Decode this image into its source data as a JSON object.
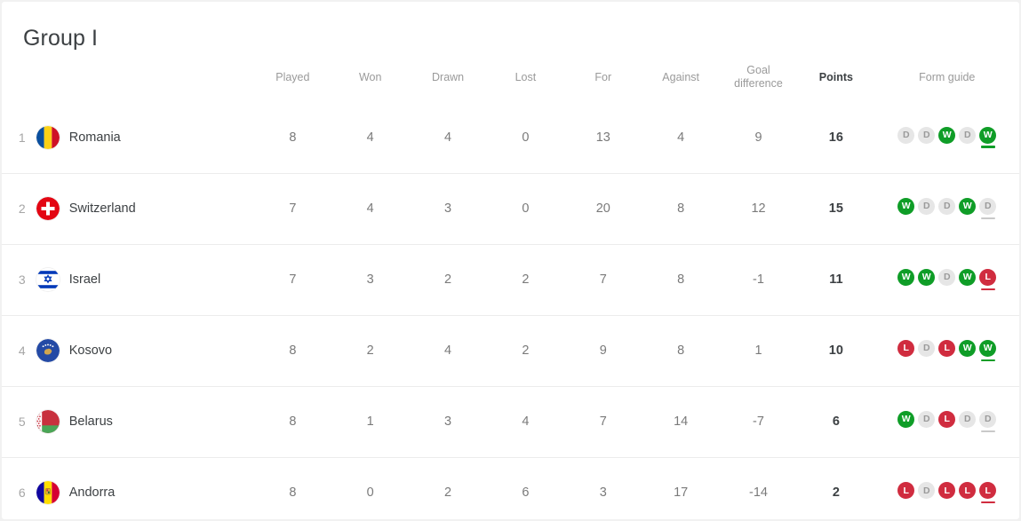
{
  "page_title": "Group I",
  "columns": {
    "rank": "",
    "team": "",
    "played": "Played",
    "won": "Won",
    "drawn": "Drawn",
    "lost": "Lost",
    "for": "For",
    "against": "Against",
    "goal_difference_line1": "Goal",
    "goal_difference_line2": "difference",
    "points": "Points",
    "form_guide": "Form guide"
  },
  "colors": {
    "win": "#0f9d27",
    "loss": "#d02c3f",
    "draw": "#e6e6e6",
    "text_primary": "#3c4043",
    "text_secondary": "#7a7a7a",
    "card_background": "#ffffff",
    "row_divider": "#ececec"
  },
  "rows": [
    {
      "rank": "1",
      "team": "Romania",
      "flag": "flag-romania",
      "played": "8",
      "won": "4",
      "drawn": "4",
      "lost": "0",
      "for": "13",
      "against": "4",
      "goal_difference": "9",
      "points": "16",
      "form": [
        "D",
        "D",
        "W",
        "D",
        "W"
      ],
      "form_latest_index": 4
    },
    {
      "rank": "2",
      "team": "Switzerland",
      "flag": "flag-switzerland",
      "played": "7",
      "won": "4",
      "drawn": "3",
      "lost": "0",
      "for": "20",
      "against": "8",
      "goal_difference": "12",
      "points": "15",
      "form": [
        "W",
        "D",
        "D",
        "W",
        "D"
      ],
      "form_latest_index": 4
    },
    {
      "rank": "3",
      "team": "Israel",
      "flag": "flag-israel",
      "played": "7",
      "won": "3",
      "drawn": "2",
      "lost": "2",
      "for": "7",
      "against": "8",
      "goal_difference": "-1",
      "points": "11",
      "form": [
        "W",
        "W",
        "D",
        "W",
        "L"
      ],
      "form_latest_index": 4
    },
    {
      "rank": "4",
      "team": "Kosovo",
      "flag": "flag-kosovo",
      "played": "8",
      "won": "2",
      "drawn": "4",
      "lost": "2",
      "for": "9",
      "against": "8",
      "goal_difference": "1",
      "points": "10",
      "form": [
        "L",
        "D",
        "L",
        "W",
        "W"
      ],
      "form_latest_index": 4
    },
    {
      "rank": "5",
      "team": "Belarus",
      "flag": "flag-belarus",
      "played": "8",
      "won": "1",
      "drawn": "3",
      "lost": "4",
      "for": "7",
      "against": "14",
      "goal_difference": "-7",
      "points": "6",
      "form": [
        "W",
        "D",
        "L",
        "D",
        "D"
      ],
      "form_latest_index": 4
    },
    {
      "rank": "6",
      "team": "Andorra",
      "flag": "flag-andorra",
      "played": "8",
      "won": "0",
      "drawn": "2",
      "lost": "6",
      "for": "3",
      "against": "17",
      "goal_difference": "-14",
      "points": "2",
      "form": [
        "L",
        "D",
        "L",
        "L",
        "L"
      ],
      "form_latest_index": 4
    }
  ]
}
